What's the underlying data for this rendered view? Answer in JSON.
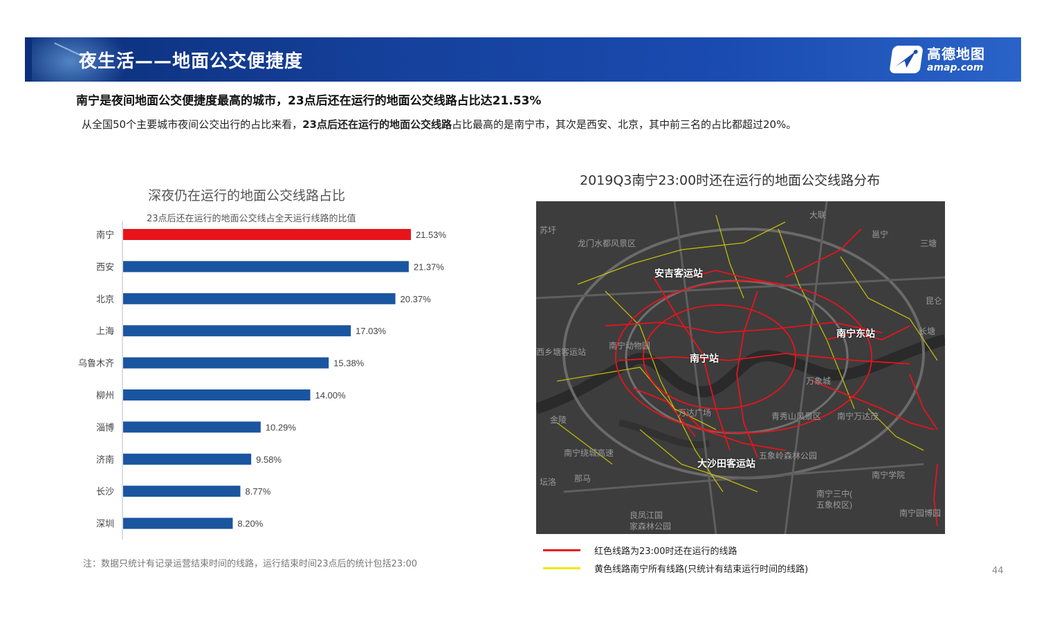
{
  "header": {
    "title": "夜生活——地面公交便捷度",
    "logo": {
      "cn": "高德地图",
      "en": "amap.com"
    },
    "colors": {
      "bar_start": "#0b2f7a",
      "bar_end": "#2a63c8"
    }
  },
  "headline": "南宁是夜间地面公交便捷度最高的城市，23点后还在运行的地面公交线路占比达21.53%",
  "subline": {
    "part1": "从全国50个主要城市夜间公交出行的占比来看，",
    "bold": "23点后还在运行的地面公交线路",
    "part2": "占比最高的是南宁市，其次是西安、北京，其中前三名的占比都超过20%。"
  },
  "chart_title": "深夜仍在运行的地面公交线路占比",
  "chart_subtitle": "23点后还在运行的地面公交线占全天运行线路的比值",
  "chart_data": {
    "type": "bar",
    "orientation": "horizontal",
    "title": "深夜仍在运行的地面公交线路占比",
    "subtitle": "23点后还在运行的地面公交线占全天运行线路的比值",
    "categories": [
      "南宁",
      "西安",
      "北京",
      "上海",
      "乌鲁木齐",
      "柳州",
      "淄博",
      "济南",
      "长沙",
      "深圳"
    ],
    "values": [
      21.53,
      21.37,
      20.37,
      17.03,
      15.38,
      14.0,
      10.29,
      9.58,
      8.77,
      8.2
    ],
    "value_labels": [
      "21.53%",
      "21.37%",
      "20.37%",
      "17.03%",
      "15.38%",
      "14.00%",
      "10.29%",
      "9.58%",
      "8.77%",
      "8.20%"
    ],
    "unit": "%",
    "xlim": [
      0,
      25
    ],
    "grid": false,
    "highlight_color": "#e8141b",
    "bar_color": "#1a55a0"
  },
  "note": "注：数据只统计有记录运营结束时间的线路，运行结束时间23点后的统计包括23:00",
  "map": {
    "title": "2019Q3南宁23:00时还在运行的地面公交线路分布",
    "highlight_labels": [
      "安吉客运站",
      "南宁东站",
      "南宁站",
      "大沙田客运站"
    ],
    "place_labels": [
      "龙门水都风景区",
      "南宁动物园",
      "西乡塘客运站",
      "万达广场",
      "青秀山风景区",
      "南宁万达茂",
      "五象岭森林公园",
      "南宁学院",
      "南宁三中(五象校区)",
      "良凤江国家森林公园",
      "万象城",
      "南宁绕城高速",
      "邕宁",
      "大联",
      "那马",
      "南宁园博园",
      "三塘",
      "昆仑",
      "长塘",
      "金陵",
      "坛洛",
      "苏圩"
    ],
    "legend": [
      {
        "label": "红色线路为23:00时还在运行的线路",
        "color": "#e8141b"
      },
      {
        "label": "黄色线路南宁所有线路(只统计有结束运行时间的线路)",
        "color": "#f2e600"
      }
    ]
  },
  "page_number": "44"
}
